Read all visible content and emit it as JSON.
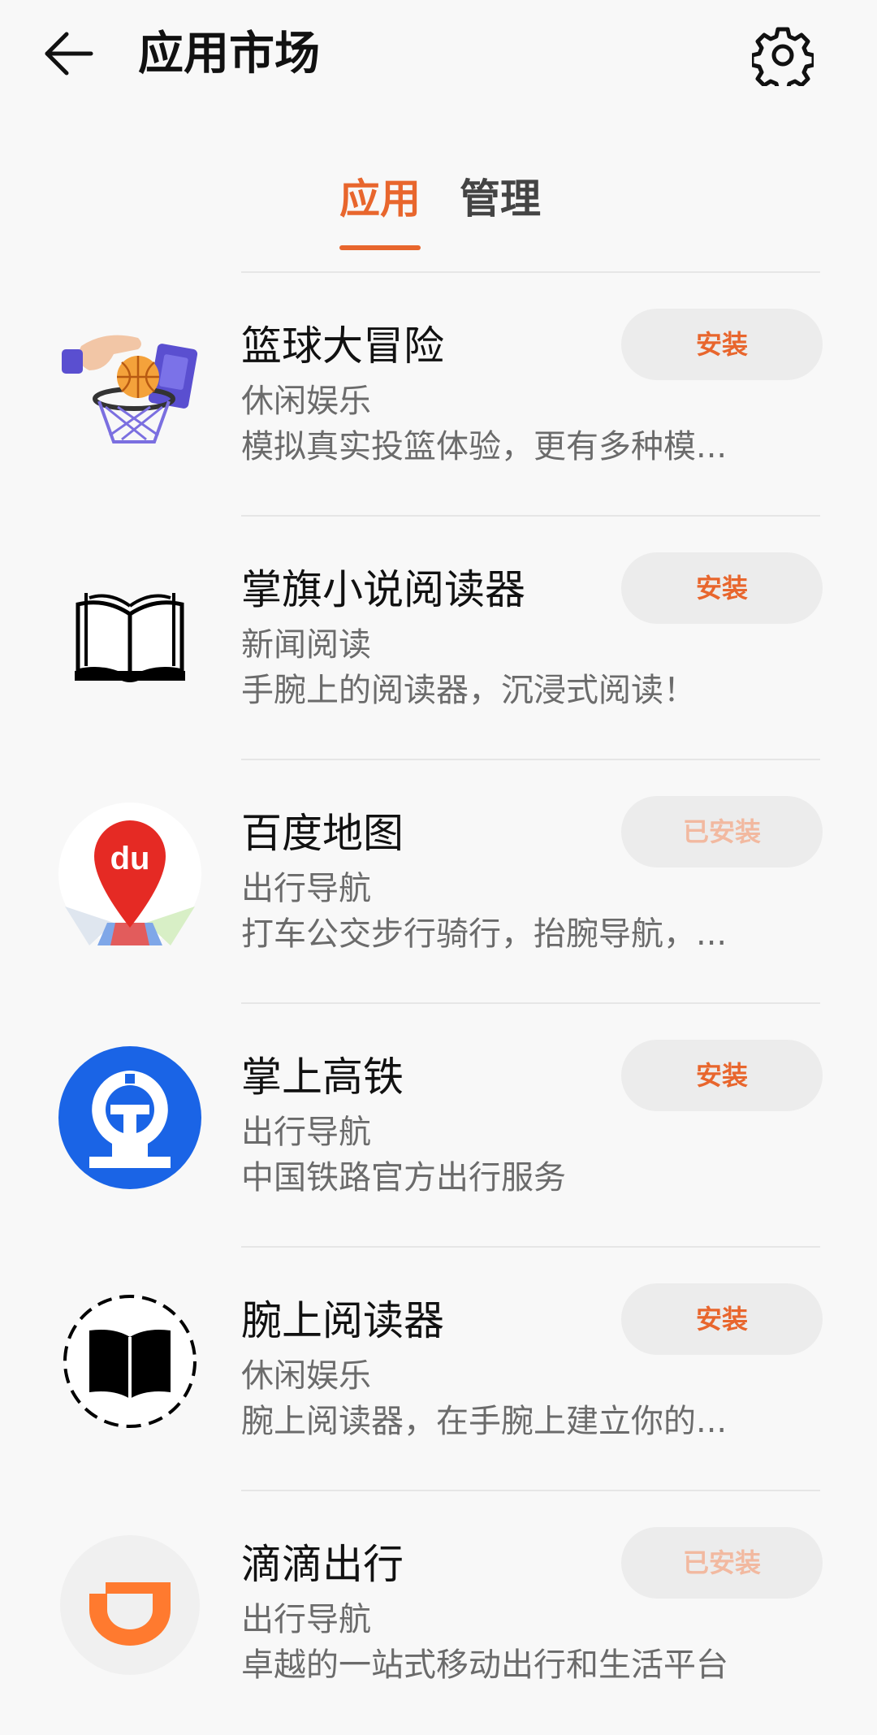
{
  "header": {
    "title": "应用市场",
    "back_icon": "back-arrow-icon",
    "settings_icon": "gear-icon"
  },
  "tabs": [
    {
      "label": "应用",
      "active": true
    },
    {
      "label": "管理",
      "active": false
    }
  ],
  "colors": {
    "accent": "#e8662d",
    "accent_faded": "#f2b9a0",
    "button_bg": "#ececec",
    "page_bg": "#f8f8f8"
  },
  "apps": [
    {
      "name": "篮球大冒险",
      "category": "休闲娱乐",
      "desc": "模拟真实投篮体验，更有多种模...",
      "button": "安装",
      "installed": false,
      "icon": "basketball-hoop-icon"
    },
    {
      "name": "掌旗小说阅读器",
      "category": "新闻阅读",
      "desc": "手腕上的阅读器，沉浸式阅读！",
      "button": "安装",
      "installed": false,
      "icon": "open-book-icon"
    },
    {
      "name": "百度地图",
      "category": "出行导航",
      "desc": "打车公交步行骑行，抬腕导航，...",
      "button": "已安装",
      "installed": true,
      "icon": "baidu-map-pin-icon"
    },
    {
      "name": "掌上高铁",
      "category": "出行导航",
      "desc": "中国铁路官方出行服务",
      "button": "安装",
      "installed": false,
      "icon": "china-railway-logo-icon"
    },
    {
      "name": "腕上阅读器",
      "category": "休闲娱乐",
      "desc": "腕上阅读器，在手腕上建立你的...",
      "button": "安装",
      "installed": false,
      "icon": "book-dashed-circle-icon"
    },
    {
      "name": "滴滴出行",
      "category": "出行导航",
      "desc": "卓越的一站式移动出行和生活平台",
      "button": "已安装",
      "installed": true,
      "icon": "didi-logo-icon"
    }
  ]
}
